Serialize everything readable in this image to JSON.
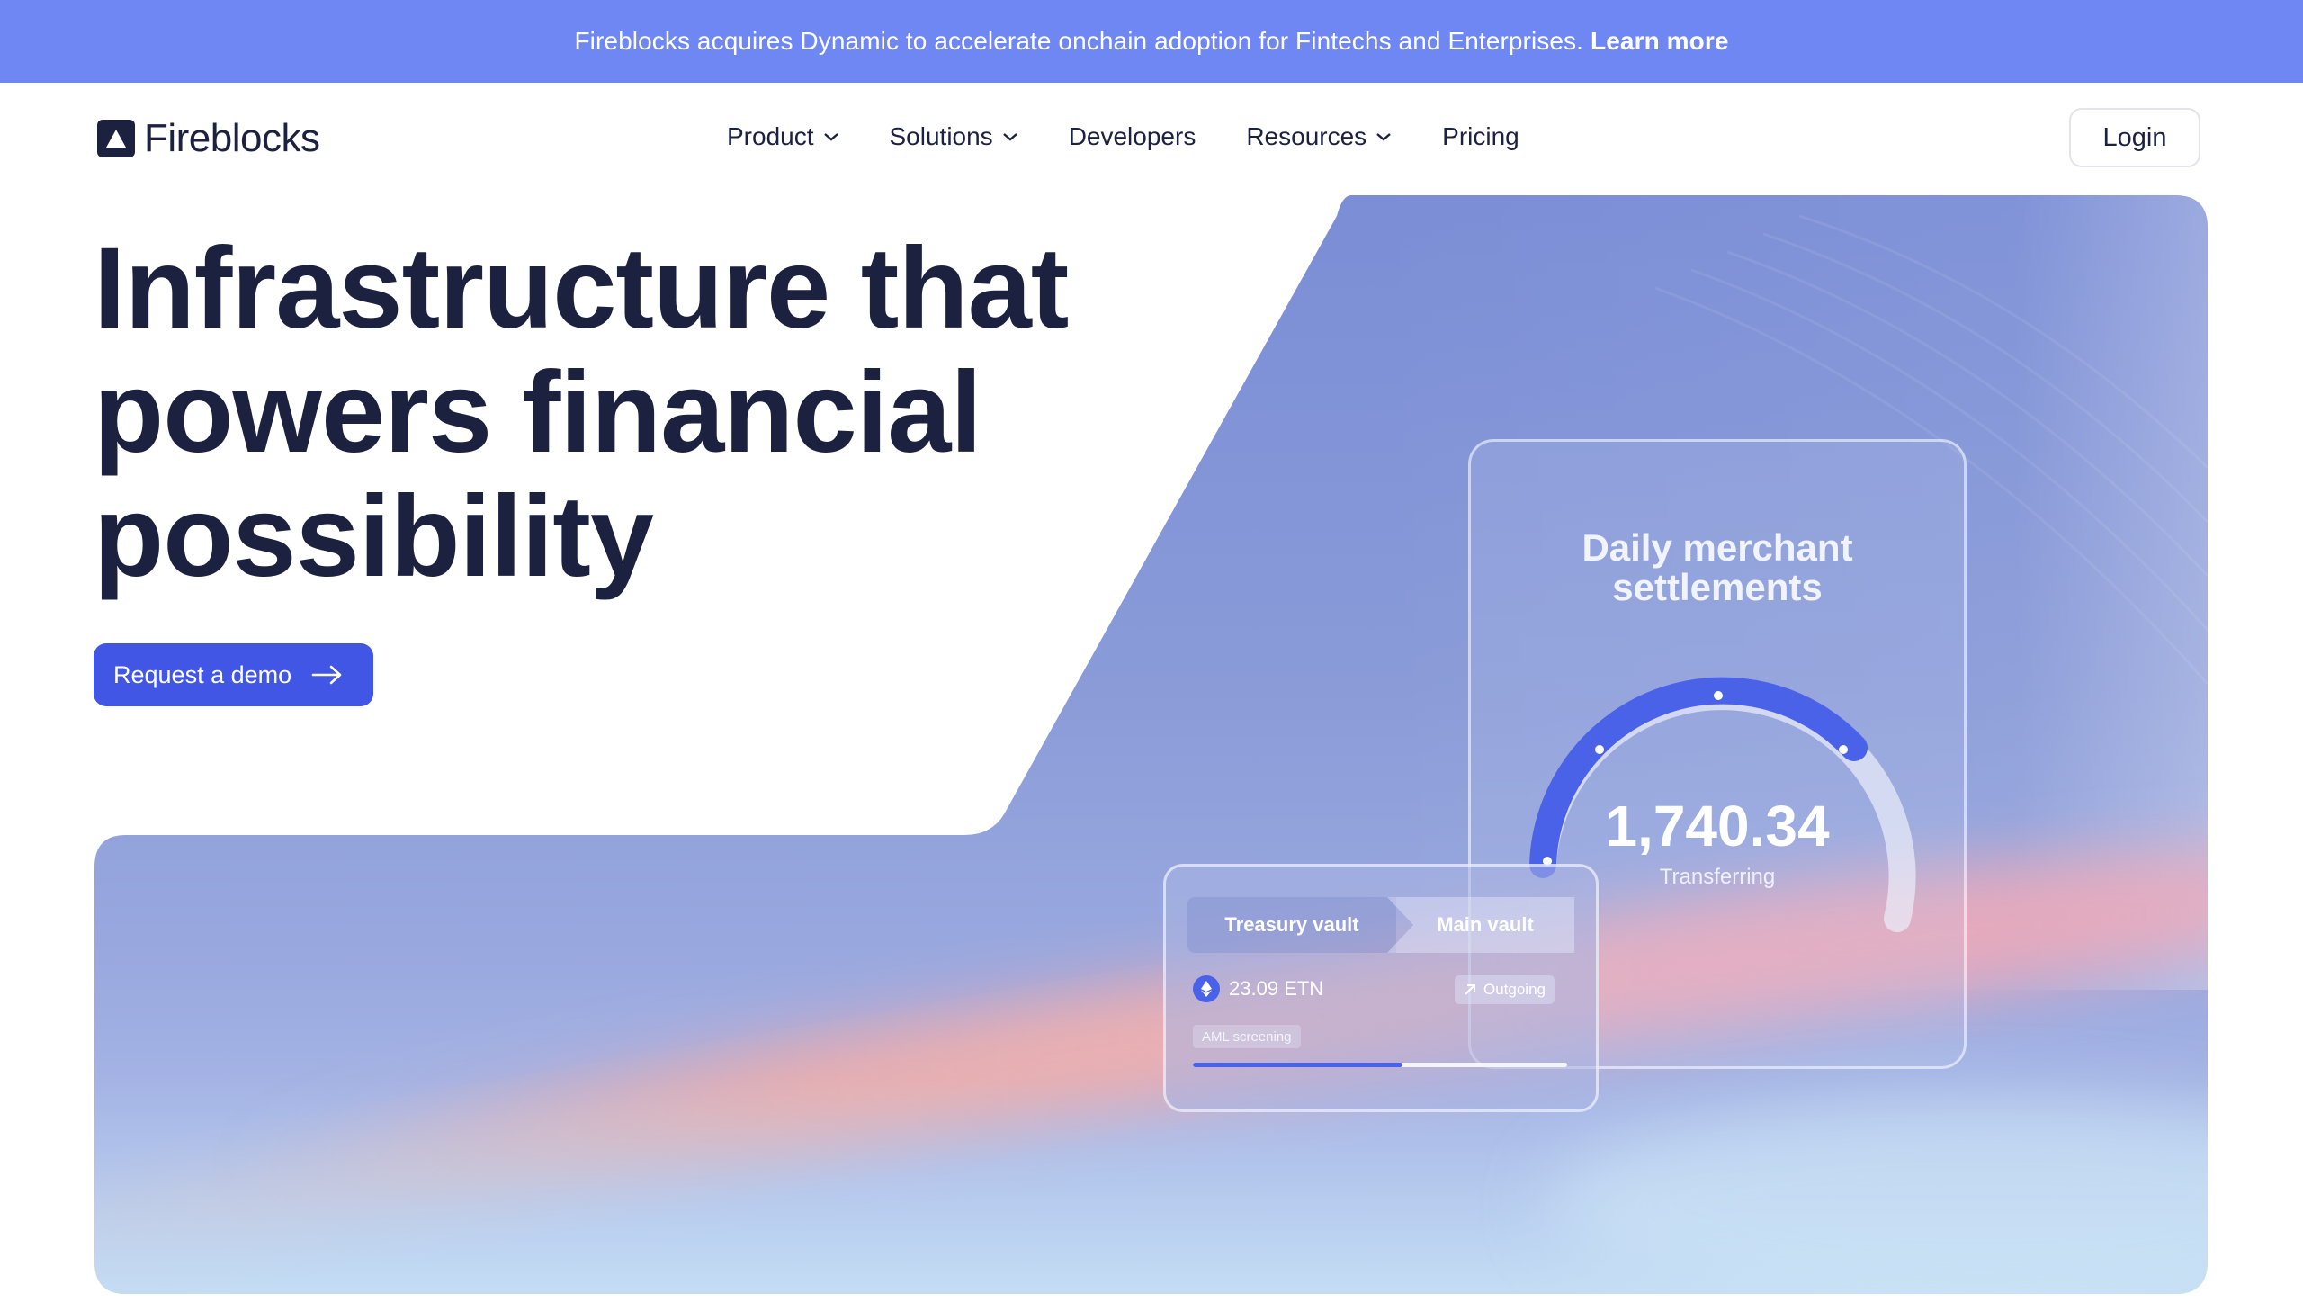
{
  "banner": {
    "text": "Fireblocks acquires Dynamic to accelerate onchain adoption for Fintechs and Enterprises.",
    "link_label": "Learn more"
  },
  "nav": {
    "logo_text": "Fireblocks",
    "items": [
      {
        "label": "Product",
        "has_dropdown": true
      },
      {
        "label": "Solutions",
        "has_dropdown": true
      },
      {
        "label": "Developers",
        "has_dropdown": false
      },
      {
        "label": "Resources",
        "has_dropdown": true
      },
      {
        "label": "Pricing",
        "has_dropdown": false
      }
    ],
    "login_label": "Login"
  },
  "hero": {
    "title_lines": [
      "Infrastructure that",
      "powers financial",
      "possibility"
    ],
    "cta_label": "Request a demo"
  },
  "gauge_card": {
    "title": "Daily merchant settlements",
    "value": "1,740.34",
    "status": "Transferring"
  },
  "vault_card": {
    "tab_from": "Treasury vault",
    "tab_to": "Main vault",
    "amount": "23.09",
    "currency": "ETN",
    "direction": "Outgoing",
    "check": "AML screening",
    "progress": 0.56
  },
  "colors": {
    "banner": "#6f87f2",
    "text_dark": "#1c2140",
    "accent": "#4256e6"
  }
}
